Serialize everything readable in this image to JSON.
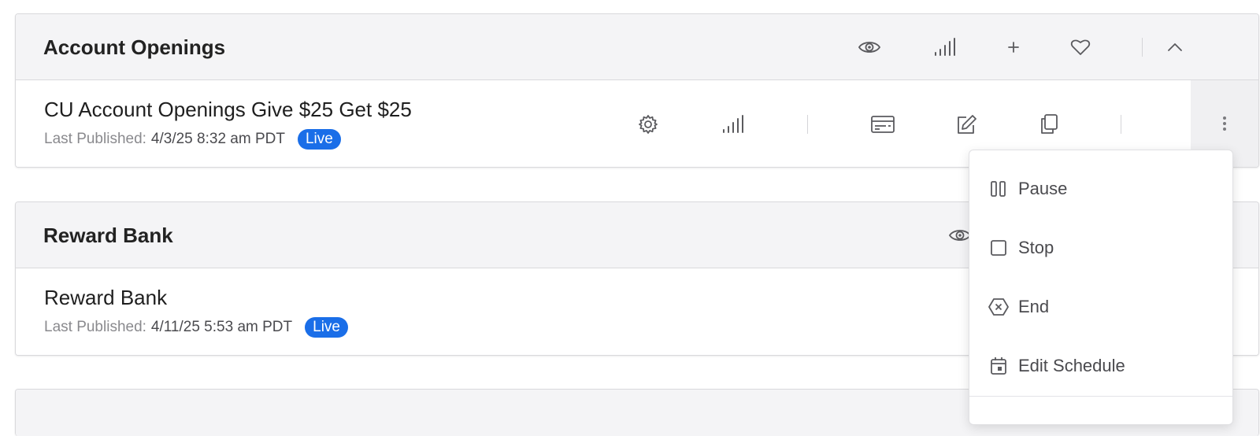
{
  "sections": [
    {
      "title": "Account Openings",
      "header_icons": [
        "eye-icon",
        "signal-bars-icon",
        "plus-icon",
        "heart-icon",
        "chevron-up-icon"
      ],
      "rows": [
        {
          "title": "CU Account Openings Give $25 Get $25",
          "meta_label": "Last Published:",
          "meta_date": "4/3/25 8:32 am PDT",
          "status": "Live",
          "row_icons": [
            "gear-icon",
            "signal-bars-icon",
            "card-icon",
            "edit-icon",
            "copy-icon",
            "more-vertical-icon"
          ]
        }
      ]
    },
    {
      "title": "Reward Bank",
      "header_icons": [
        "eye-icon"
      ],
      "rows": [
        {
          "title": "Reward Bank",
          "meta_label": "Last Published:",
          "meta_date": "4/11/25 5:53 am PDT",
          "status": "Live"
        }
      ]
    }
  ],
  "dropdown_menu": {
    "items": [
      {
        "label": "Pause",
        "icon": "pause-icon"
      },
      {
        "label": "Stop",
        "icon": "stop-icon"
      },
      {
        "label": "End",
        "icon": "end-icon"
      },
      {
        "label": "Edit Schedule",
        "icon": "calendar-icon"
      }
    ]
  },
  "colors": {
    "live_badge": "#1a6ee8",
    "header_bg": "#f4f4f6",
    "icon": "#5a5a5e"
  }
}
